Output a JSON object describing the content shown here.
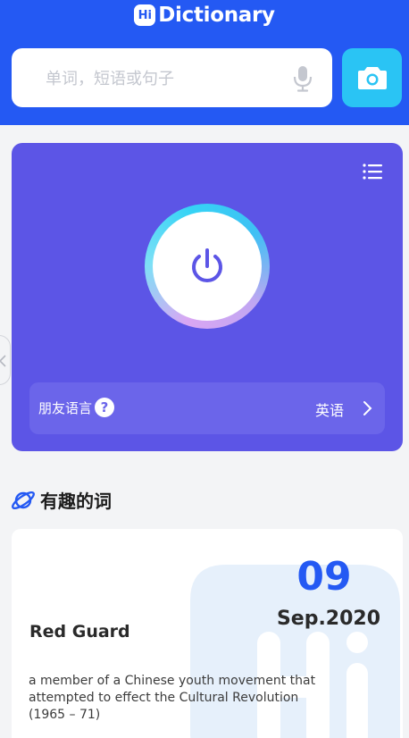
{
  "header": {
    "logo_badge": "Hi",
    "logo_text": "Dictionary",
    "background": "#2459f3"
  },
  "search": {
    "placeholder": "单词，短语或句子",
    "mic_icon": "microphone-icon",
    "camera_icon": "camera-icon",
    "camera_color": "#2ac4f4"
  },
  "translator_card": {
    "background": "#5c55e6",
    "menu_icon": "list-menu-icon",
    "power_icon": "power-icon",
    "language_label": "朋友语言",
    "help_icon": "question-icon",
    "language_value": "英语",
    "chevron_icon": "chevron-right-icon"
  },
  "interesting_words": {
    "title": "有趣的词",
    "icon": "planet-icon",
    "day": "09",
    "month": "Sep.2020",
    "word": "Red Guard",
    "definition": "a member of a Chinese youth movement that attempted to effect the Cultural Revolution (1965 – 71)"
  }
}
